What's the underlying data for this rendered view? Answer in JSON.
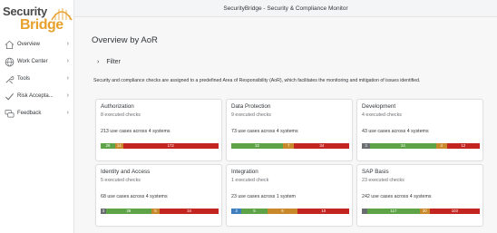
{
  "app_title": "SecurityBridge - Security & Compliance Monitor",
  "logo": {
    "word1": "Security",
    "word2": "Bridge"
  },
  "colors": {
    "grey": "#6a6d70",
    "green": "#5ea348",
    "orange": "#c9882a",
    "red": "#c32520",
    "blue": "#3f7fc0",
    "brand": "#e8a02c"
  },
  "sidebar": {
    "items": [
      {
        "label": "Overview",
        "icon": "home-icon"
      },
      {
        "label": "Work Center",
        "icon": "globe-icon"
      },
      {
        "label": "Tools",
        "icon": "tools-icon"
      },
      {
        "label": "Risk Accepta...",
        "icon": "checkmark-icon"
      },
      {
        "label": "Feedback",
        "icon": "feedback-icon"
      }
    ]
  },
  "main": {
    "title": "Overview by AoR",
    "filter_label": "Filter",
    "info": "Security and compliance checks are assigned to a predefined Area of Responsibility (AoR), which facilitates the monitoring and mitigation of issues identified."
  },
  "cards": [
    {
      "title": "Authorization",
      "checks": "8 executed checks",
      "uses": "213 use cases across 4 systems",
      "segments": [
        {
          "value": 26,
          "label": "26",
          "color": "green"
        },
        {
          "value": 14,
          "label": "14",
          "color": "orange"
        },
        {
          "value": 172,
          "label": "172",
          "color": "red"
        }
      ]
    },
    {
      "title": "Data Protection",
      "checks": "9 executed checks",
      "uses": "73 use cases across 4 systems",
      "segments": [
        {
          "value": 32,
          "label": "32",
          "color": "green"
        },
        {
          "value": 7,
          "label": "7",
          "color": "orange"
        },
        {
          "value": 34,
          "label": "34",
          "color": "red"
        }
      ]
    },
    {
      "title": "Development",
      "checks": "4 executed checks",
      "uses": "43 use cases across 4 systems",
      "segments": [
        {
          "value": 3,
          "label": "3",
          "color": "grey"
        },
        {
          "value": 24,
          "label": "24",
          "color": "green"
        },
        {
          "value": 4,
          "label": "4",
          "color": "orange"
        },
        {
          "value": 12,
          "label": "12",
          "color": "red"
        }
      ]
    },
    {
      "title": "Identity and Access",
      "checks": "5 executed checks",
      "uses": "68 use cases across 4 systems",
      "segments": [
        {
          "value": 3,
          "label": "3",
          "color": "grey"
        },
        {
          "value": 26,
          "label": "26",
          "color": "green"
        },
        {
          "value": 5,
          "label": "5",
          "color": "orange"
        },
        {
          "value": 34,
          "label": "34",
          "color": "red"
        }
      ]
    },
    {
      "title": "Integration",
      "checks": "1 executed check",
      "uses": "23 use cases across 1 system",
      "segments": [
        {
          "value": 2,
          "label": "2",
          "color": "blue"
        },
        {
          "value": 5,
          "label": "5",
          "color": "green"
        },
        {
          "value": 6,
          "label": "6",
          "color": "orange"
        },
        {
          "value": 10,
          "label": "10",
          "color": "red"
        }
      ]
    },
    {
      "title": "SAP Basis",
      "checks": "23 executed checks",
      "uses": "242 use cases across 4 systems",
      "segments": [
        {
          "value": 2,
          "label": "",
          "color": "grey"
        },
        {
          "value": 117,
          "label": "117",
          "color": "green"
        },
        {
          "value": 20,
          "label": "20",
          "color": "orange"
        },
        {
          "value": 103,
          "label": "103",
          "color": "red"
        }
      ]
    }
  ]
}
